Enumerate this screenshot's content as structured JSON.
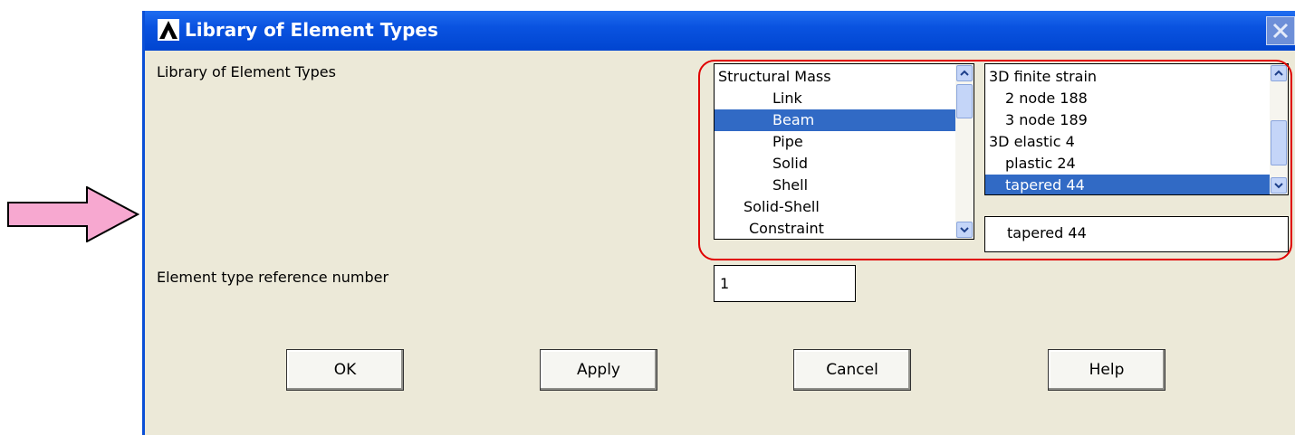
{
  "window": {
    "title": "Library of Element Types"
  },
  "form": {
    "library_label": "Library of Element Types",
    "ref_number_label": "Element type reference number",
    "ref_number_value": "1"
  },
  "category_list": {
    "items": [
      {
        "label": "Structural Mass",
        "selected": false
      },
      {
        "label": "Link",
        "selected": false
      },
      {
        "label": "Beam",
        "selected": true
      },
      {
        "label": "Pipe",
        "selected": false
      },
      {
        "label": "Solid",
        "selected": false
      },
      {
        "label": "Shell",
        "selected": false
      },
      {
        "label": "Solid-Shell",
        "selected": false
      },
      {
        "label": "Constraint",
        "selected": false
      }
    ]
  },
  "type_list": {
    "items": [
      {
        "label": "3D finite strain",
        "selected": false
      },
      {
        "label": "2 node   188",
        "selected": false
      },
      {
        "label": "3 node   189",
        "selected": false
      },
      {
        "label": "3D elastic    4",
        "selected": false
      },
      {
        "label": "plastic   24",
        "selected": false
      },
      {
        "label": "tapered   44",
        "selected": true
      }
    ],
    "selected_value": "tapered   44"
  },
  "buttons": {
    "ok": "OK",
    "apply": "Apply",
    "cancel": "Cancel",
    "help": "Help"
  },
  "colors": {
    "selection": "#316ac5",
    "highlight": "#e00000",
    "arrow_fill": "#f7a8d0"
  },
  "icons": {
    "app": "ansys-logo-icon",
    "close": "close-icon",
    "pointer": "pointer-arrow-icon"
  }
}
